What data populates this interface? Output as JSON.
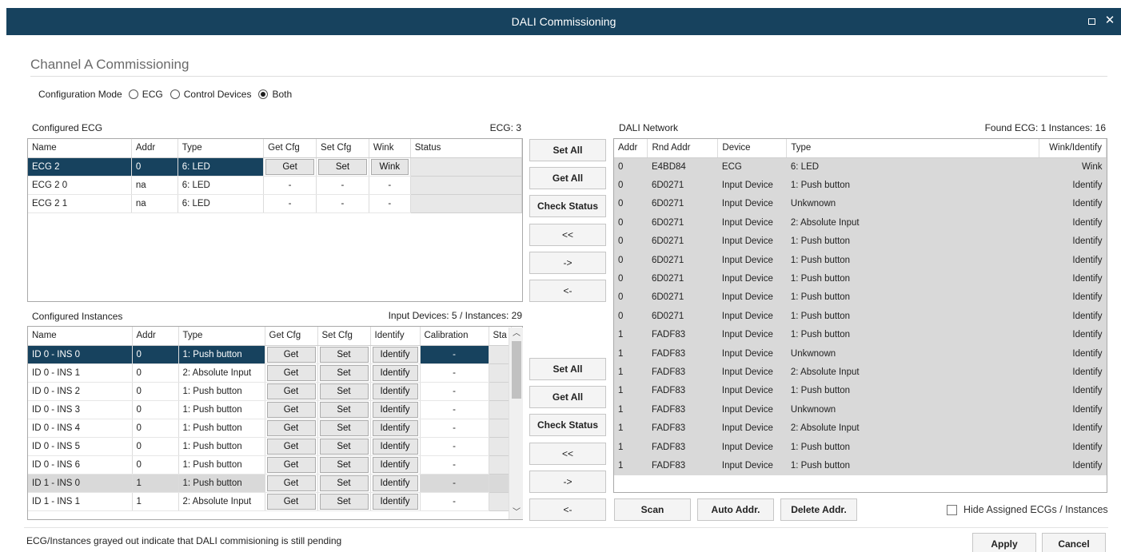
{
  "window": {
    "title": "DALI Commissioning"
  },
  "header": {
    "section_title": "Channel A Commissioning"
  },
  "config_mode": {
    "label": "Configuration Mode",
    "options": [
      {
        "label": "ECG",
        "selected": false
      },
      {
        "label": "Control Devices",
        "selected": false
      },
      {
        "label": "Both",
        "selected": true
      }
    ]
  },
  "ecg_panel": {
    "title": "Configured ECG",
    "count": "ECG: 3",
    "columns": [
      "Name",
      "Addr",
      "Type",
      "Get Cfg",
      "Set Cfg",
      "Wink",
      "Status"
    ],
    "rows": [
      {
        "name": "ECG 2",
        "addr": "0",
        "type": "6: LED",
        "get": "Get",
        "set": "Set",
        "wink": "Wink",
        "status": ""
      },
      {
        "name": "ECG 2 0",
        "addr": "na",
        "type": "6: LED",
        "get": "-",
        "set": "-",
        "wink": "-",
        "status": ""
      },
      {
        "name": "ECG 2 1",
        "addr": "na",
        "type": "6: LED",
        "get": "-",
        "set": "-",
        "wink": "-",
        "status": ""
      }
    ]
  },
  "instances_panel": {
    "title": "Configured Instances",
    "count": "Input Devices: 5 / Instances: 29",
    "columns": [
      "Name",
      "Addr",
      "Type",
      "Get Cfg",
      "Set Cfg",
      "Identify",
      "Calibration",
      "Sta"
    ],
    "rows": [
      {
        "name": "ID 0 - INS 0",
        "addr": "0",
        "type": "1: Push button",
        "get": "Get",
        "set": "Set",
        "identify": "Identify",
        "calibration": "-"
      },
      {
        "name": "ID 0 - INS 1",
        "addr": "0",
        "type": "2: Absolute Input",
        "get": "Get",
        "set": "Set",
        "identify": "Identify",
        "calibration": "-"
      },
      {
        "name": "ID 0 - INS 2",
        "addr": "0",
        "type": "1: Push button",
        "get": "Get",
        "set": "Set",
        "identify": "Identify",
        "calibration": "-"
      },
      {
        "name": "ID 0 - INS 3",
        "addr": "0",
        "type": "1: Push button",
        "get": "Get",
        "set": "Set",
        "identify": "Identify",
        "calibration": "-"
      },
      {
        "name": "ID 0 - INS 4",
        "addr": "0",
        "type": "1: Push button",
        "get": "Get",
        "set": "Set",
        "identify": "Identify",
        "calibration": "-"
      },
      {
        "name": "ID 0 - INS 5",
        "addr": "0",
        "type": "1: Push button",
        "get": "Get",
        "set": "Set",
        "identify": "Identify",
        "calibration": "-"
      },
      {
        "name": "ID 0 - INS 6",
        "addr": "0",
        "type": "1: Push button",
        "get": "Get",
        "set": "Set",
        "identify": "Identify",
        "calibration": "-"
      },
      {
        "name": "ID 1 - INS 0",
        "addr": "1",
        "type": "1: Push button",
        "get": "Get",
        "set": "Set",
        "identify": "Identify",
        "calibration": "-"
      },
      {
        "name": "ID 1 - INS 1",
        "addr": "1",
        "type": "2: Absolute Input",
        "get": "Get",
        "set": "Set",
        "identify": "Identify",
        "calibration": "-"
      }
    ]
  },
  "side_buttons_top": [
    "Set All",
    "Get All",
    "Check Status",
    "<<",
    "->",
    "<-"
  ],
  "side_buttons_bottom": [
    "Set All",
    "Get All",
    "Check Status",
    "<<",
    "->",
    "<-"
  ],
  "network_panel": {
    "title": "DALI Network",
    "count": "Found ECG: 1 Instances: 16",
    "columns": [
      "Addr",
      "Rnd Addr",
      "Device",
      "Type",
      "Wink/Identify"
    ],
    "rows": [
      {
        "addr": "0",
        "rnd": "E4BD84",
        "device": "ECG",
        "type": "6: LED",
        "action": "Wink"
      },
      {
        "addr": "0",
        "rnd": "6D0271",
        "device": "Input Device",
        "type": "1: Push button",
        "action": "Identify"
      },
      {
        "addr": "0",
        "rnd": "6D0271",
        "device": "Input Device",
        "type": "Unkwnown",
        "action": "Identify"
      },
      {
        "addr": "0",
        "rnd": "6D0271",
        "device": "Input Device",
        "type": "2: Absolute Input",
        "action": "Identify"
      },
      {
        "addr": "0",
        "rnd": "6D0271",
        "device": "Input Device",
        "type": "1: Push button",
        "action": "Identify"
      },
      {
        "addr": "0",
        "rnd": "6D0271",
        "device": "Input Device",
        "type": "1: Push button",
        "action": "Identify"
      },
      {
        "addr": "0",
        "rnd": "6D0271",
        "device": "Input Device",
        "type": "1: Push button",
        "action": "Identify"
      },
      {
        "addr": "0",
        "rnd": "6D0271",
        "device": "Input Device",
        "type": "1: Push button",
        "action": "Identify"
      },
      {
        "addr": "0",
        "rnd": "6D0271",
        "device": "Input Device",
        "type": "1: Push button",
        "action": "Identify"
      },
      {
        "addr": "1",
        "rnd": "FADF83",
        "device": "Input Device",
        "type": "1: Push button",
        "action": "Identify"
      },
      {
        "addr": "1",
        "rnd": "FADF83",
        "device": "Input Device",
        "type": "Unkwnown",
        "action": "Identify"
      },
      {
        "addr": "1",
        "rnd": "FADF83",
        "device": "Input Device",
        "type": "2: Absolute Input",
        "action": "Identify"
      },
      {
        "addr": "1",
        "rnd": "FADF83",
        "device": "Input Device",
        "type": "1: Push button",
        "action": "Identify"
      },
      {
        "addr": "1",
        "rnd": "FADF83",
        "device": "Input Device",
        "type": "Unkwnown",
        "action": "Identify"
      },
      {
        "addr": "1",
        "rnd": "FADF83",
        "device": "Input Device",
        "type": "2: Absolute Input",
        "action": "Identify"
      },
      {
        "addr": "1",
        "rnd": "FADF83",
        "device": "Input Device",
        "type": "1: Push button",
        "action": "Identify"
      },
      {
        "addr": "1",
        "rnd": "FADF83",
        "device": "Input Device",
        "type": "1: Push button",
        "action": "Identify"
      }
    ]
  },
  "network_buttons": {
    "scan": "Scan",
    "auto_addr": "Auto Addr.",
    "delete_addr": "Delete Addr."
  },
  "hide_assigned": {
    "label": "Hide Assigned ECGs / Instances",
    "checked": false
  },
  "footer": {
    "note": "ECG/Instances grayed out indicate that DALI commisioning is still pending",
    "apply": "Apply",
    "cancel": "Cancel"
  },
  "colors": {
    "titlebar": "#17425e",
    "selection": "#17425e",
    "pending_row": "#d9d9d9"
  }
}
